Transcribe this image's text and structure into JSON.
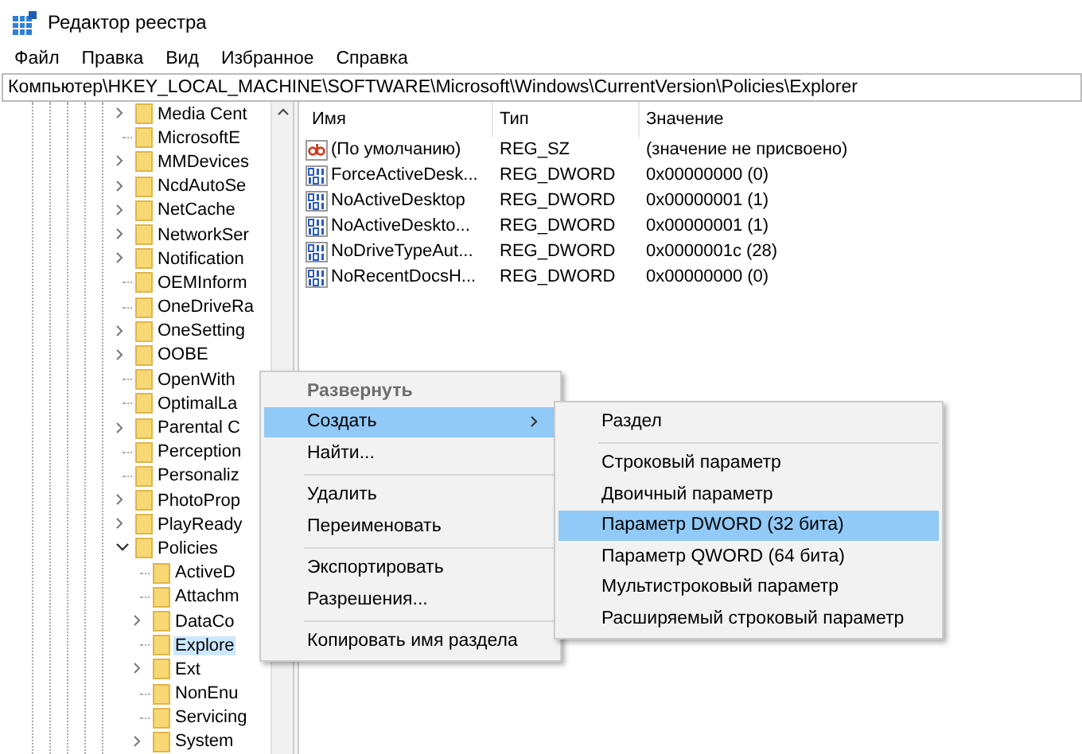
{
  "window": {
    "title": "Редактор реестра"
  },
  "menu_bar": [
    "Файл",
    "Правка",
    "Вид",
    "Избранное",
    "Справка"
  ],
  "address": "Компьютер\\HKEY_LOCAL_MACHINE\\SOFTWARE\\Microsoft\\Windows\\CurrentVersion\\Policies\\Explorer",
  "tree": [
    {
      "label": "Media Cent",
      "has_children": true,
      "expanded": false,
      "selected": false
    },
    {
      "label": "MicrosoftE",
      "has_children": false,
      "expanded": false,
      "selected": false
    },
    {
      "label": "MMDevices",
      "has_children": true,
      "expanded": false,
      "selected": false
    },
    {
      "label": "NcdAutoSe",
      "has_children": true,
      "expanded": false,
      "selected": false
    },
    {
      "label": "NetCache",
      "has_children": true,
      "expanded": false,
      "selected": false
    },
    {
      "label": "NetworkSer",
      "has_children": true,
      "expanded": false,
      "selected": false
    },
    {
      "label": "Notification",
      "has_children": true,
      "expanded": false,
      "selected": false
    },
    {
      "label": "OEMInform",
      "has_children": false,
      "expanded": false,
      "selected": false
    },
    {
      "label": "OneDriveRa",
      "has_children": false,
      "expanded": false,
      "selected": false
    },
    {
      "label": "OneSetting",
      "has_children": true,
      "expanded": false,
      "selected": false
    },
    {
      "label": "OOBE",
      "has_children": true,
      "expanded": false,
      "selected": false
    },
    {
      "label": "OpenWith",
      "has_children": false,
      "expanded": false,
      "selected": false
    },
    {
      "label": "OptimalLa",
      "has_children": false,
      "expanded": false,
      "selected": false
    },
    {
      "label": "Parental C",
      "has_children": true,
      "expanded": false,
      "selected": false
    },
    {
      "label": "Perception",
      "has_children": false,
      "expanded": false,
      "selected": false
    },
    {
      "label": "Personaliz",
      "has_children": false,
      "expanded": false,
      "selected": false
    },
    {
      "label": "PhotoProp",
      "has_children": true,
      "expanded": false,
      "selected": false
    },
    {
      "label": "PlayReady",
      "has_children": true,
      "expanded": false,
      "selected": false
    },
    {
      "label": "Policies",
      "has_children": true,
      "expanded": true,
      "selected": false,
      "children": [
        {
          "label": "ActiveD",
          "has_children": false,
          "expanded": false,
          "selected": false
        },
        {
          "label": "Attachm",
          "has_children": false,
          "expanded": false,
          "selected": false
        },
        {
          "label": "DataCo",
          "has_children": true,
          "expanded": false,
          "selected": false
        },
        {
          "label": "Explore",
          "has_children": false,
          "expanded": false,
          "selected": true
        },
        {
          "label": "Ext",
          "has_children": true,
          "expanded": false,
          "selected": false
        },
        {
          "label": "NonEnu",
          "has_children": false,
          "expanded": false,
          "selected": false
        },
        {
          "label": "Servicing",
          "has_children": false,
          "expanded": false,
          "selected": false
        },
        {
          "label": "System",
          "has_children": true,
          "expanded": false,
          "selected": false
        }
      ]
    }
  ],
  "list": {
    "columns": [
      "Имя",
      "Тип",
      "Значение"
    ],
    "rows": [
      {
        "kind": "string",
        "name": "(По умолчанию)",
        "type": "REG_SZ",
        "value": "(значение не присвоено)"
      },
      {
        "kind": "binary",
        "name": "ForceActiveDesk...",
        "type": "REG_DWORD",
        "value": "0x00000000 (0)"
      },
      {
        "kind": "binary",
        "name": "NoActiveDesktop",
        "type": "REG_DWORD",
        "value": "0x00000001 (1)"
      },
      {
        "kind": "binary",
        "name": "NoActiveDeskto...",
        "type": "REG_DWORD",
        "value": "0x00000001 (1)"
      },
      {
        "kind": "binary",
        "name": "NoDriveTypeAut...",
        "type": "REG_DWORD",
        "value": "0x0000001c (28)"
      },
      {
        "kind": "binary",
        "name": "NoRecentDocsH...",
        "type": "REG_DWORD",
        "value": "0x00000000 (0)"
      }
    ]
  },
  "context_menu": [
    {
      "kind": "item",
      "label": "Развернуть",
      "disabled": true,
      "selected": false,
      "submenu": false
    },
    {
      "kind": "item",
      "label": "Создать",
      "disabled": false,
      "selected": true,
      "submenu": true
    },
    {
      "kind": "item",
      "label": "Найти...",
      "disabled": false,
      "selected": false,
      "submenu": false
    },
    {
      "kind": "separator"
    },
    {
      "kind": "item",
      "label": "Удалить",
      "disabled": false,
      "selected": false,
      "submenu": false
    },
    {
      "kind": "item",
      "label": "Переименовать",
      "disabled": false,
      "selected": false,
      "submenu": false
    },
    {
      "kind": "separator"
    },
    {
      "kind": "item",
      "label": "Экспортировать",
      "disabled": false,
      "selected": false,
      "submenu": false
    },
    {
      "kind": "item",
      "label": "Разрешения...",
      "disabled": false,
      "selected": false,
      "submenu": false
    },
    {
      "kind": "separator"
    },
    {
      "kind": "item",
      "label": "Копировать имя раздела",
      "disabled": false,
      "selected": false,
      "submenu": false
    }
  ],
  "submenu": [
    {
      "kind": "item",
      "label": "Раздел",
      "selected": false
    },
    {
      "kind": "separator"
    },
    {
      "kind": "item",
      "label": "Строковый параметр",
      "selected": false
    },
    {
      "kind": "item",
      "label": "Двоичный параметр",
      "selected": false
    },
    {
      "kind": "item",
      "label": "Параметр DWORD (32 бита)",
      "selected": true
    },
    {
      "kind": "item",
      "label": "Параметр QWORD (64 бита)",
      "selected": false
    },
    {
      "kind": "item",
      "label": "Мультистроковый параметр",
      "selected": false
    },
    {
      "kind": "item",
      "label": "Расширяемый строковый параметр",
      "selected": false
    }
  ]
}
